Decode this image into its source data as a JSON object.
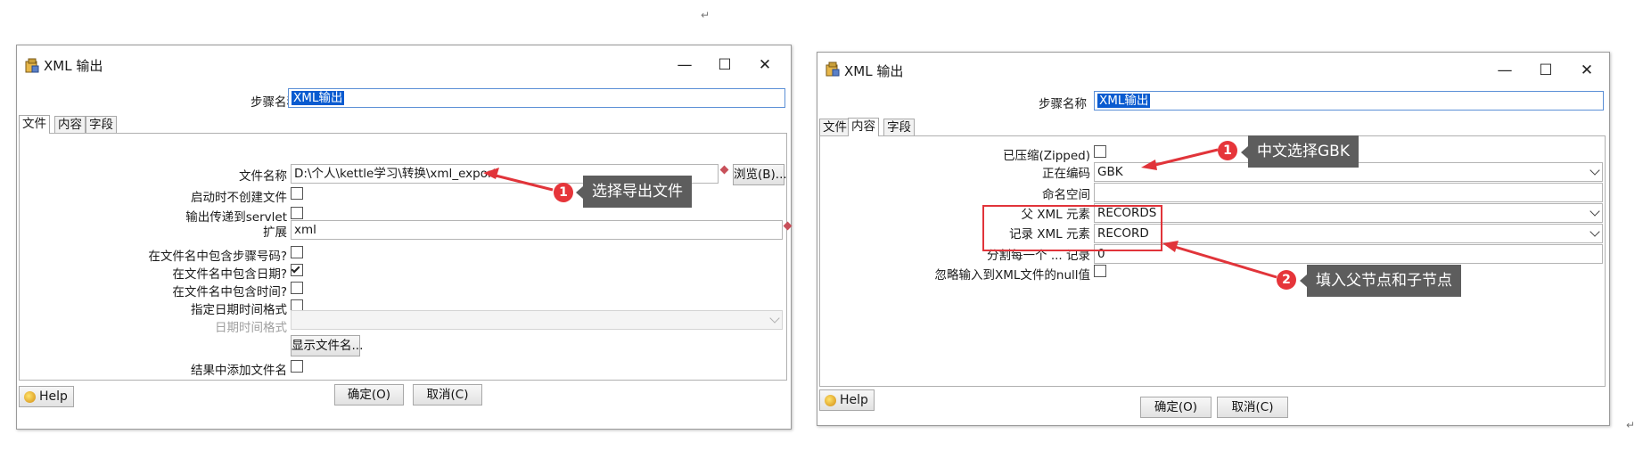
{
  "page": {
    "para_mark": "↵"
  },
  "left": {
    "title": "XML 输出",
    "step_label": "步骤名称",
    "step_value": "XML输出",
    "tabs": [
      "文件",
      "内容",
      "字段"
    ],
    "fields": {
      "filename_label": "文件名称",
      "filename_value": "D:\\个人\\kettle学习\\转换\\xml_export",
      "browse": "浏览(B)...",
      "no_create_label": "启动时不创建文件",
      "servlet_label": "输出传递到servlet",
      "ext_label": "扩展",
      "ext_value": "xml",
      "stepnr_label": "在文件名中包含步骤号码?",
      "date_label": "在文件名中包含日期?",
      "time_label": "在文件名中包含时间?",
      "datefmt_spec_label": "指定日期时间格式",
      "datefmt_label": "日期时间格式",
      "show_files": "显示文件名...",
      "add_result_label": "结果中添加文件名"
    },
    "checks": {
      "no_create": false,
      "servlet": false,
      "stepnr": false,
      "date": true,
      "time": false,
      "datefmt_spec": false,
      "add_result": false
    },
    "help": "Help",
    "ok": "确定(O)",
    "cancel": "取消(C)",
    "callout": {
      "num": "1",
      "text": "选择导出文件"
    }
  },
  "right": {
    "title": "XML 输出",
    "step_label": "步骤名称",
    "step_value": "XML输出",
    "tabs": [
      "文件",
      "内容",
      "字段"
    ],
    "fields": {
      "zipped_label": "已压缩(Zipped)",
      "encoding_label": "正在编码",
      "encoding_value": "GBK",
      "namespace_label": "命名空间",
      "namespace_value": "",
      "parent_label": "父 XML 元素",
      "parent_value": "RECORDS",
      "record_label": "记录 XML 元素",
      "record_value": "RECORD",
      "split_label": "分割每一个 ... 记录",
      "split_value": "0",
      "omit_null_label": "忽略输入到XML文件的null值"
    },
    "checks": {
      "zipped": false,
      "omit_null": false
    },
    "help": "Help",
    "ok": "确定(O)",
    "cancel": "取消(C)",
    "callout1": {
      "num": "1",
      "text": "中文选择GBK"
    },
    "callout2": {
      "num": "2",
      "text": "填入父节点和子节点"
    }
  },
  "colors": {
    "annotation_red": "#e1343a",
    "callout_bg": "#5d5d5d",
    "selection": "#0a5bd0"
  }
}
